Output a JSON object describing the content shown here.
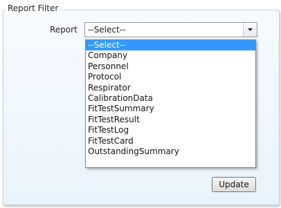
{
  "filter_panel": {
    "legend": "Report Filter",
    "report_label": "Report",
    "report_select": {
      "value": "--Select--",
      "options": [
        "--Select--",
        "Company",
        "Personnel",
        "Protocol",
        "Respirator",
        "CalibrationData",
        "FitTestSummary",
        "FitTestResult",
        "FitTestLog",
        "FitTestCard",
        "OutstandingSummary"
      ],
      "highlighted_index": 0
    },
    "update_label": "Update"
  },
  "colors": {
    "highlight": "#3399ff",
    "panel_border": "#c9d3dc"
  },
  "icons": {
    "dropdown_arrow": "chevron-down-icon"
  }
}
